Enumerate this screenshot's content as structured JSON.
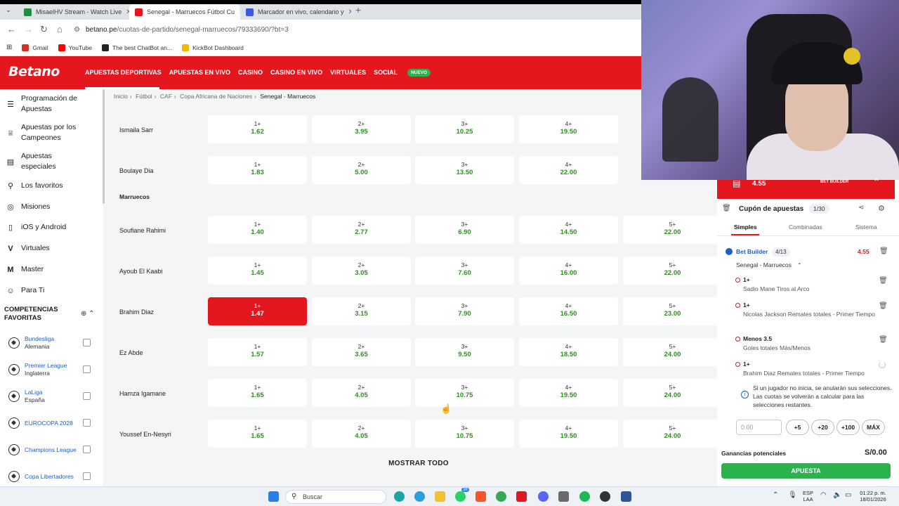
{
  "browser": {
    "tabs": [
      {
        "title": "MisaelHV Stream - Watch Live",
        "color": "#1f8f3f"
      },
      {
        "title": "Senegal - Marruecos Fútbol Cu",
        "color": "#e3171d"
      },
      {
        "title": "Marcador en vivo, calendario y",
        "color": "#3b5bdb"
      }
    ],
    "new_tab": "+",
    "url_host": "betano.pe",
    "url_path": "/cuotas-de-partido/senegal-marruecos/79333690/?bt=3",
    "bookmarks": [
      {
        "label": "Gmail",
        "color": "#d93025"
      },
      {
        "label": "YouTube",
        "color": "#ff0000"
      },
      {
        "label": "The best ChatBot an...",
        "color": "#222222"
      },
      {
        "label": "KickBot Dashboard",
        "color": "#f2b705"
      }
    ]
  },
  "header": {
    "logo": "Betano",
    "nav": [
      "APUESTAS DEPORTIVAS",
      "APUESTAS EN VIVO",
      "CASINO",
      "CASINO EN VIVO",
      "VIRTUALES",
      "SOCIAL"
    ],
    "nuevo_badge": "NUEVO"
  },
  "sidebar": {
    "items": [
      {
        "label": "Programación de Apuestas",
        "icon": "calendar-list-icon"
      },
      {
        "label": "Apuestas por los Campeones",
        "icon": "trophy-icon"
      },
      {
        "label": "Apuestas especiales",
        "icon": "ticket-icon"
      },
      {
        "label": "Los favoritos",
        "icon": "pin-icon"
      },
      {
        "label": "Misiones",
        "icon": "target-icon"
      },
      {
        "label": "iOS y Android",
        "icon": "phone-icon"
      },
      {
        "label": "Virtuales",
        "icon": "virtual-v-icon"
      },
      {
        "label": "Master",
        "icon": "master-icon"
      },
      {
        "label": "Para Ti",
        "icon": "user-icon"
      }
    ],
    "competitions_title": "COMPETENCIAS FAVORITAS",
    "competitions": [
      {
        "name": "Bundesliga",
        "country": "Alemania"
      },
      {
        "name": "Premier League",
        "country": "Inglaterra"
      },
      {
        "name": "LaLiga",
        "country": "España"
      },
      {
        "name": "EUROCOPA 2028",
        "country": ""
      },
      {
        "name": "Champions League",
        "country": ""
      },
      {
        "name": "Copa Libertadores",
        "country": ""
      }
    ]
  },
  "breadcrumb": [
    "Inicio",
    "Fútbol",
    "CAF",
    "Copa Africana de Naciones",
    "Senegal - Marruecos"
  ],
  "market": {
    "team_label": "Marruecos",
    "rows_senegal": [
      {
        "player": "Ismaila Sarr",
        "odds": [
          [
            "1+",
            "1.62"
          ],
          [
            "2+",
            "3.95"
          ],
          [
            "3+",
            "10.25"
          ],
          [
            "4+",
            "19.50"
          ]
        ]
      },
      {
        "player": "Boulaye Dia",
        "odds": [
          [
            "1+",
            "1.83"
          ],
          [
            "2+",
            "5.00"
          ],
          [
            "3+",
            "13.50"
          ],
          [
            "4+",
            "22.00"
          ]
        ]
      }
    ],
    "rows_marruecos": [
      {
        "player": "Soufiane Rahimi",
        "odds": [
          [
            "1+",
            "1.40"
          ],
          [
            "2+",
            "2.77"
          ],
          [
            "3+",
            "6.90"
          ],
          [
            "4+",
            "14.50"
          ],
          [
            "5+",
            "22.00"
          ]
        ]
      },
      {
        "player": "Ayoub El Kaabi",
        "odds": [
          [
            "1+",
            "1.45"
          ],
          [
            "2+",
            "3.05"
          ],
          [
            "3+",
            "7.60"
          ],
          [
            "4+",
            "16.00"
          ],
          [
            "5+",
            "22.00"
          ]
        ]
      },
      {
        "player": "Brahim Diaz",
        "odds": [
          [
            "1+",
            "1.47"
          ],
          [
            "2+",
            "3.15"
          ],
          [
            "3+",
            "7.90"
          ],
          [
            "4+",
            "16.50"
          ],
          [
            "5+",
            "23.00"
          ]
        ]
      },
      {
        "player": "Ez Abde",
        "odds": [
          [
            "1+",
            "1.57"
          ],
          [
            "2+",
            "3.65"
          ],
          [
            "3+",
            "9.50"
          ],
          [
            "4+",
            "18.50"
          ],
          [
            "5+",
            "24.00"
          ]
        ]
      },
      {
        "player": "Hamza Igamane",
        "odds": [
          [
            "1+",
            "1.65"
          ],
          [
            "2+",
            "4.05"
          ],
          [
            "3+",
            "10.75"
          ],
          [
            "4+",
            "19.50"
          ],
          [
            "5+",
            "24.00"
          ]
        ]
      },
      {
        "player": "Youssef En-Nesyri",
        "odds": [
          [
            "1+",
            "1.65"
          ],
          [
            "2+",
            "4.05"
          ],
          [
            "3+",
            "10.75"
          ],
          [
            "4+",
            "19.50"
          ],
          [
            "5+",
            "24.00"
          ]
        ]
      }
    ],
    "selected": {
      "player": "Brahim Diaz",
      "odd": "1.47"
    },
    "show_all": "MOSTRAR TODO"
  },
  "slip": {
    "total_odds": "4.55",
    "bb_tag": "BET BUILDER",
    "title": "Cupón de apuestas",
    "count": "1/30",
    "tabs": [
      "Simples",
      "Combinadas",
      "Sistema"
    ],
    "bet_builder": {
      "label": "Bet Builder",
      "count": "4/13",
      "odds": "4.55"
    },
    "match": "Senegal - Marruecos",
    "legs": [
      {
        "pick": "1+",
        "market": "Sadio Mane Tiros al Arco"
      },
      {
        "pick": "1+",
        "market": "Nicolas Jackson Remates totales - Primer Tiempo"
      },
      {
        "pick": "Menos 3.5",
        "market": "Goles totales Más/Menos"
      },
      {
        "pick": "1+",
        "market": "Brahim Diaz Remates totales - Primer Tiempo"
      }
    ],
    "info": "Si un jugador no inicia, se anularán sus selecciones. Las cuotas se volverán a calcular para las selecciones restantes.",
    "stake_placeholder": "0.00",
    "quick": [
      "+5",
      "+20",
      "+100",
      "MÁX"
    ],
    "potential_label": "Ganancias potenciales",
    "potential_value": "S/0.00",
    "place_bet": "APUESTA"
  },
  "taskbar": {
    "search": "Buscar",
    "lang": "ESP",
    "lang2": "LAA",
    "time": "01:22 p. m.",
    "date": "18/01/2026",
    "badge": "38"
  },
  "colors": {
    "brand": "#e3171d",
    "odds_green": "#2f8f1f",
    "cta": "#2bb24c",
    "link": "#1f5fbf"
  }
}
